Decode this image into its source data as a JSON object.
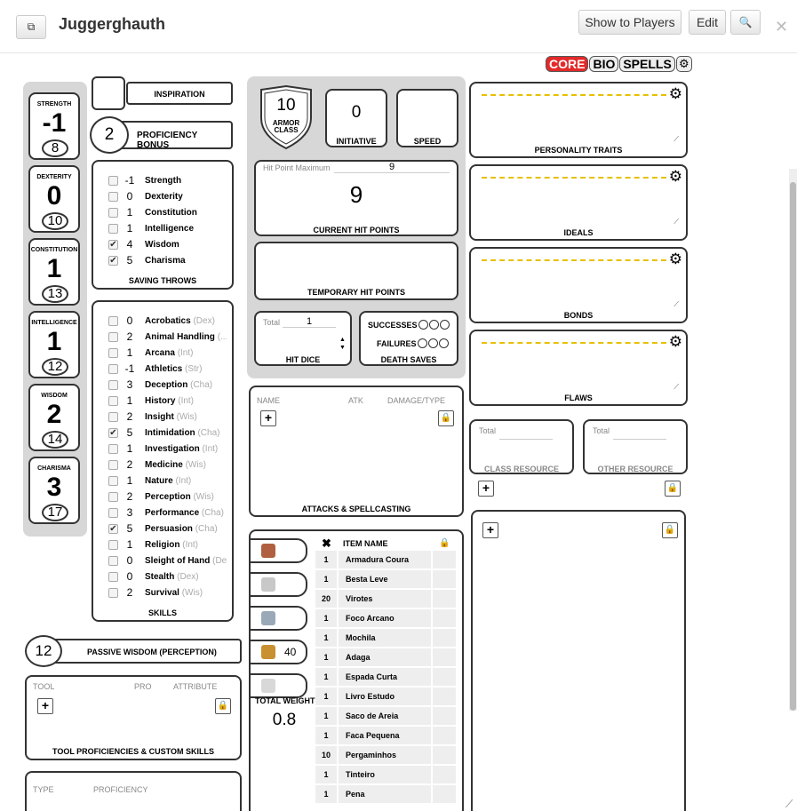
{
  "window": {
    "title": "Juggerghauth",
    "show_players": "Show to Players",
    "edit": "Edit"
  },
  "tabs": [
    "CORE",
    "BIO",
    "SPELLS"
  ],
  "attributes": [
    {
      "name": "STRENGTH",
      "value": "-1",
      "score": "8"
    },
    {
      "name": "DEXTERITY",
      "value": "0",
      "score": "10"
    },
    {
      "name": "CONSTITUTION",
      "value": "1",
      "score": "13"
    },
    {
      "name": "INTELLIGENCE",
      "value": "1",
      "score": "12"
    },
    {
      "name": "WISDOM",
      "value": "2",
      "score": "14"
    },
    {
      "name": "CHARISMA",
      "value": "3",
      "score": "17"
    }
  ],
  "inspiration": "INSPIRATION",
  "proficiency": {
    "value": "2",
    "label": "PROFICIENCY BONUS"
  },
  "saving_throws": {
    "label": "SAVING THROWS",
    "items": [
      {
        "v": "-1",
        "n": "Strength",
        "c": false
      },
      {
        "v": "0",
        "n": "Dexterity",
        "c": false
      },
      {
        "v": "1",
        "n": "Constitution",
        "c": false
      },
      {
        "v": "1",
        "n": "Intelligence",
        "c": false
      },
      {
        "v": "4",
        "n": "Wisdom",
        "c": true
      },
      {
        "v": "5",
        "n": "Charisma",
        "c": true
      }
    ]
  },
  "skills": {
    "label": "SKILLS",
    "items": [
      {
        "v": "0",
        "n": "Acrobatics",
        "a": "(Dex)",
        "c": false
      },
      {
        "v": "2",
        "n": "Animal Handling",
        "a": "(...",
        "c": false
      },
      {
        "v": "1",
        "n": "Arcana",
        "a": "(Int)",
        "c": false
      },
      {
        "v": "-1",
        "n": "Athletics",
        "a": "(Str)",
        "c": false
      },
      {
        "v": "3",
        "n": "Deception",
        "a": "(Cha)",
        "c": false
      },
      {
        "v": "1",
        "n": "History",
        "a": "(Int)",
        "c": false
      },
      {
        "v": "2",
        "n": "Insight",
        "a": "(Wis)",
        "c": false
      },
      {
        "v": "5",
        "n": "Intimidation",
        "a": "(Cha)",
        "c": true
      },
      {
        "v": "1",
        "n": "Investigation",
        "a": "(Int)",
        "c": false
      },
      {
        "v": "2",
        "n": "Medicine",
        "a": "(Wis)",
        "c": false
      },
      {
        "v": "1",
        "n": "Nature",
        "a": "(Int)",
        "c": false
      },
      {
        "v": "2",
        "n": "Perception",
        "a": "(Wis)",
        "c": false
      },
      {
        "v": "3",
        "n": "Performance",
        "a": "(Cha)",
        "c": false
      },
      {
        "v": "5",
        "n": "Persuasion",
        "a": "(Cha)",
        "c": true
      },
      {
        "v": "1",
        "n": "Religion",
        "a": "(Int)",
        "c": false
      },
      {
        "v": "0",
        "n": "Sleight of Hand",
        "a": "(Dex)",
        "c": false
      },
      {
        "v": "0",
        "n": "Stealth",
        "a": "(Dex)",
        "c": false
      },
      {
        "v": "2",
        "n": "Survival",
        "a": "(Wis)",
        "c": false
      }
    ]
  },
  "passive": {
    "value": "12",
    "label": "PASSIVE WISDOM (PERCEPTION)"
  },
  "tools": {
    "h1": "TOOL",
    "h2": "PRO",
    "h3": "ATTRIBUTE",
    "label": "TOOL PROFICIENCIES & CUSTOM SKILLS"
  },
  "other_prof": {
    "h1": "TYPE",
    "h2": "PROFICIENCY"
  },
  "combat": {
    "ac": "10",
    "ac_label": "ARMOR CLASS",
    "init": "0",
    "init_label": "INITIATIVE",
    "speed_label": "SPEED"
  },
  "hp": {
    "max_label": "Hit Point Maximum",
    "max": "9",
    "current": "9",
    "current_label": "CURRENT HIT POINTS",
    "temp_label": "TEMPORARY HIT POINTS"
  },
  "hitdice": {
    "total_label": "Total",
    "total": "1",
    "label": "HIT DICE"
  },
  "death": {
    "succ": "SUCCESSES",
    "fail": "FAILURES",
    "label": "DEATH SAVES"
  },
  "attacks": {
    "h1": "NAME",
    "h2": "ATK",
    "h3": "DAMAGE/TYPE",
    "label": "ATTACKS & SPELLCASTING"
  },
  "coins": [
    {
      "c": "#b06040",
      "v": ""
    },
    {
      "c": "#c8c8c8",
      "v": ""
    },
    {
      "c": "#9aa9b8",
      "v": ""
    },
    {
      "c": "#c89030",
      "v": "40"
    },
    {
      "c": "#d8d8d8",
      "v": ""
    }
  ],
  "weight": {
    "label": "TOTAL WEIGHT",
    "value": "0.8"
  },
  "inventory": {
    "header": "ITEM NAME",
    "items": [
      {
        "q": "1",
        "n": "Armadura Coura"
      },
      {
        "q": "1",
        "n": "Besta Leve"
      },
      {
        "q": "20",
        "n": "Virotes"
      },
      {
        "q": "1",
        "n": "Foco Arcano"
      },
      {
        "q": "1",
        "n": "Mochila"
      },
      {
        "q": "1",
        "n": "Adaga"
      },
      {
        "q": "1",
        "n": "Espada Curta"
      },
      {
        "q": "1",
        "n": "Livro Estudo"
      },
      {
        "q": "1",
        "n": "Saco de Areia"
      },
      {
        "q": "1",
        "n": "Faca Pequena"
      },
      {
        "q": "10",
        "n": "Pergaminhos"
      },
      {
        "q": "1",
        "n": "Tinteiro"
      },
      {
        "q": "1",
        "n": "Pena"
      }
    ]
  },
  "personality": [
    "PERSONALITY TRAITS",
    "IDEALS",
    "BONDS",
    "FLAWS"
  ],
  "resources": {
    "total": "Total",
    "class": "CLASS RESOURCE",
    "other": "OTHER RESOURCE"
  }
}
